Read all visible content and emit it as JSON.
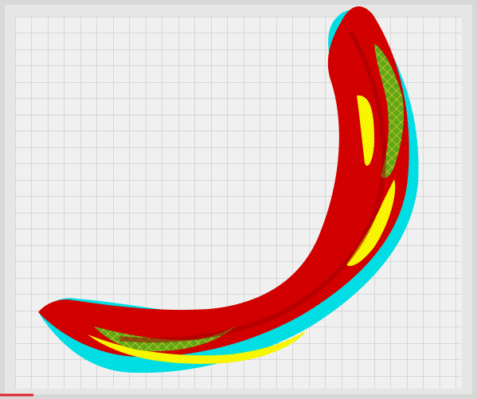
{
  "viewport": {
    "view": "layer-view",
    "content": "sliced-curved-part"
  },
  "colors": {
    "background": "#ffffff",
    "build_plate_frame": "#d8d8d8",
    "build_plate_frame_inner": "#e6e6e6",
    "build_plate_surface": "#f0f0f0",
    "grid_line": "#bfbfbf",
    "axis_x": "#e0202a",
    "outer_wall": "#e00000",
    "outer_wall_hatch": "#8a0000",
    "inner_wall": "#00e8ee",
    "skin": "#ffff00",
    "infill": "#5ea61a",
    "infill_hatch": "#e0d020"
  },
  "legend_items": []
}
